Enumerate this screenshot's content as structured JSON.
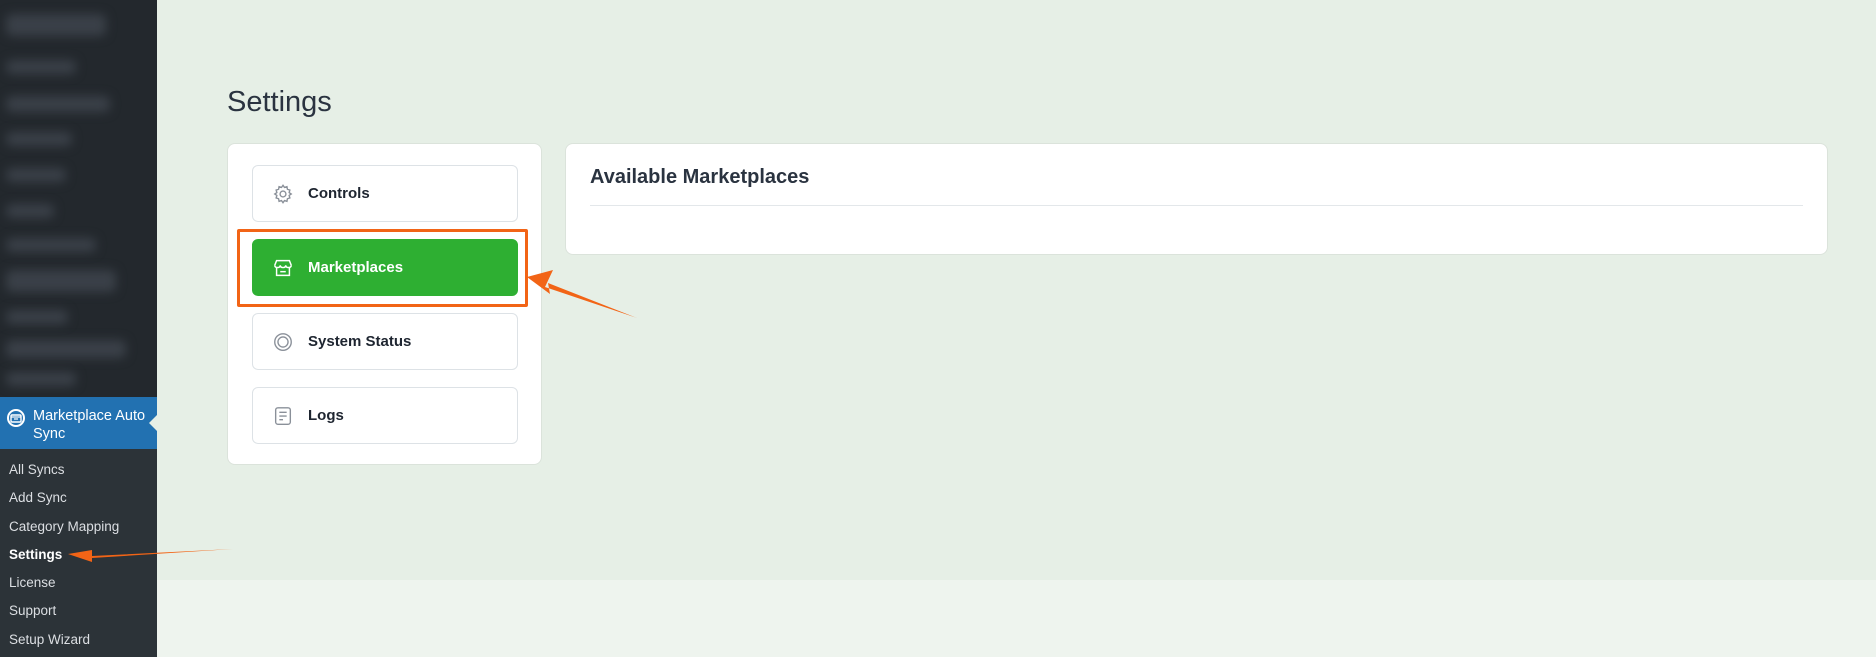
{
  "sidebar": {
    "active_menu_label": "Marketplace Auto Sync",
    "submenu": [
      {
        "label": "All Syncs"
      },
      {
        "label": "Add Sync"
      },
      {
        "label": "Category Mapping"
      },
      {
        "label": "Settings",
        "current": true
      },
      {
        "label": "License"
      },
      {
        "label": "Support"
      },
      {
        "label": "Setup Wizard"
      }
    ],
    "active_icon": "store-badge-icon"
  },
  "page": {
    "title": "Settings"
  },
  "settings_nav": [
    {
      "label": "Controls",
      "icon": "gear-icon",
      "active": false
    },
    {
      "label": "Marketplaces",
      "icon": "storefront-icon",
      "active": true
    },
    {
      "label": "System Status",
      "icon": "status-ring-icon",
      "active": false
    },
    {
      "label": "Logs",
      "icon": "log-document-icon",
      "active": false
    }
  ],
  "content": {
    "heading": "Available Marketplaces"
  },
  "colors": {
    "sidebar_bg": "#23282d",
    "sidebar_active": "#2271b1",
    "accent_green": "#2eaf32",
    "annotation_orange": "#f26416",
    "page_bg": "#e6efe6"
  }
}
